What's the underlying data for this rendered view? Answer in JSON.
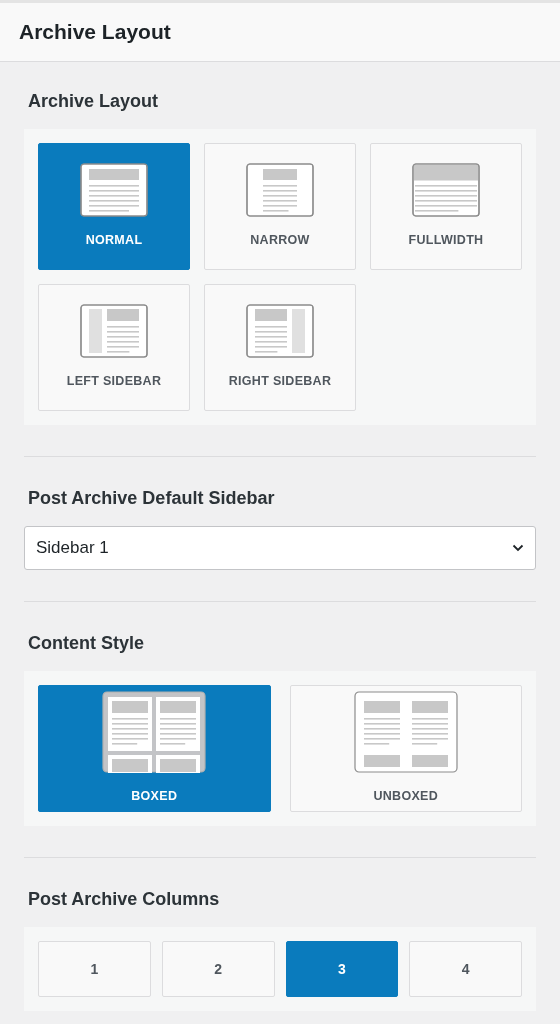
{
  "header": {
    "title": "Archive Layout"
  },
  "sections": [
    {
      "kind": "options",
      "title": "Archive Layout",
      "options": [
        {
          "label": "NORMAL",
          "kind": "normal",
          "selected": true
        },
        {
          "label": "NARROW",
          "kind": "narrow",
          "selected": false
        },
        {
          "label": "FULLWIDTH",
          "kind": "fullwidth",
          "selected": false
        },
        {
          "label": "LEFT SIDEBAR",
          "kind": "left-sidebar",
          "selected": false
        },
        {
          "label": "RIGHT SIDEBAR",
          "kind": "right-sidebar",
          "selected": false
        }
      ]
    },
    {
      "kind": "select",
      "title": "Post Archive Default Sidebar",
      "value": "Sidebar 1"
    },
    {
      "kind": "options",
      "title": "Content Style",
      "options": [
        {
          "label": "BOXED",
          "kind": "boxed",
          "selected": true
        },
        {
          "label": "UNBOXED",
          "kind": "unboxed",
          "selected": false
        }
      ]
    },
    {
      "kind": "numbers",
      "title": "Post Archive Columns",
      "options": [
        {
          "label": "1",
          "selected": false
        },
        {
          "label": "2",
          "selected": false
        },
        {
          "label": "3",
          "selected": true
        },
        {
          "label": "4",
          "selected": false
        }
      ]
    }
  ]
}
